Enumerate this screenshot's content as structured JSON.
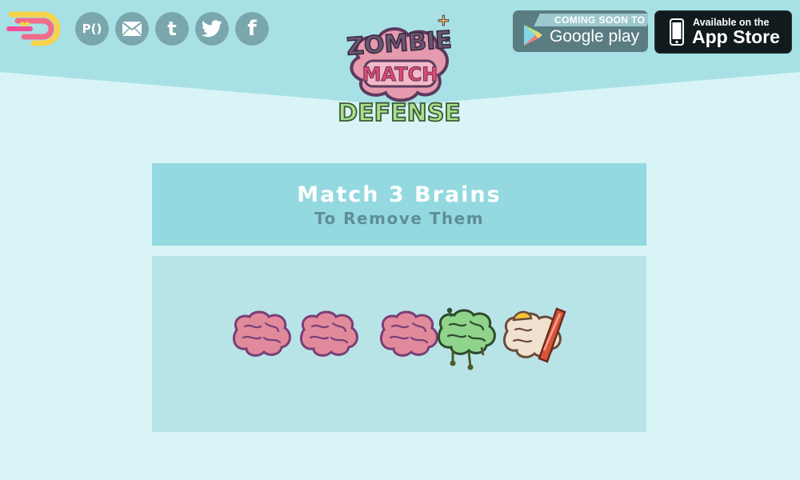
{
  "header": {
    "social": [
      {
        "name": "pro-game-icon",
        "label": "P()"
      },
      {
        "name": "mail-icon"
      },
      {
        "name": "tumblr-icon",
        "label": "t"
      },
      {
        "name": "twitter-icon"
      },
      {
        "name": "facebook-icon",
        "label": "f"
      }
    ],
    "google_play": {
      "ribbon": "COMING SOON TO",
      "label": "Google play"
    },
    "app_store": {
      "small": "Available on the",
      "big": "App Store"
    },
    "logo": {
      "line1": "ZOMBIE",
      "line2": "MATCH",
      "line3": "DEFENSE"
    }
  },
  "instruction": {
    "line1": "Match 3 Brains",
    "line2": "To Remove Them"
  },
  "board": {
    "pieces": [
      "pink-brain",
      "pink-brain",
      "pink-brain",
      "zombie-brain",
      "egg-bacon-brain"
    ]
  },
  "colors": {
    "background": "#d8f4f6",
    "header": "#a7e1e5",
    "instruction_bg": "#93d9df",
    "board_bg": "#b8e4e7",
    "social_icon": "#7aa7ad",
    "pink_brain": "#e08a9c",
    "zombie_brain": "#8fd48a"
  }
}
